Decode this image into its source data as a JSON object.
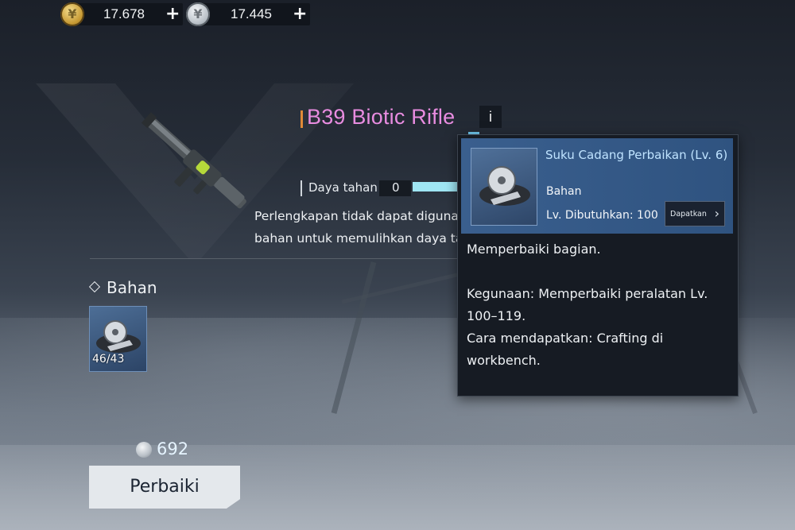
{
  "currencies": [
    {
      "icon": "gold-coin-icon",
      "value": "17.678",
      "add_label": "+"
    },
    {
      "icon": "silver-coin-icon",
      "value": "17.445",
      "add_label": "+"
    }
  ],
  "item": {
    "name": "B39 Biotic Rifle",
    "info_label": "i",
    "durability_label": "Daya tahan",
    "durability_value": "0",
    "description_line1": "Perlengkapan tidak dapat digunakan",
    "description_line2": "bahan untuk memulihkan daya tahan."
  },
  "materials": {
    "section_label": "Bahan",
    "slot_count": "46/43"
  },
  "repair": {
    "cost": "692",
    "button_label": "Perbaiki"
  },
  "tooltip": {
    "name": "Suku Cadang Perbaikan (Lv. 6)",
    "type": "Bahan",
    "required_level": "Lv. Dibutuhkan: 100",
    "obtain_button": "Dapatkan",
    "line1": "Memperbaiki bagian.",
    "line2": "Kegunaan: Memperbaiki peralatan Lv.",
    "line3": "100–119.",
    "line4": "Cara mendapatkan: Crafting di",
    "line5": "workbench."
  },
  "colors": {
    "title": "#e88ce0",
    "durability_bar": "#9fe6f4",
    "tooltip_header": "#3a5f8e"
  }
}
